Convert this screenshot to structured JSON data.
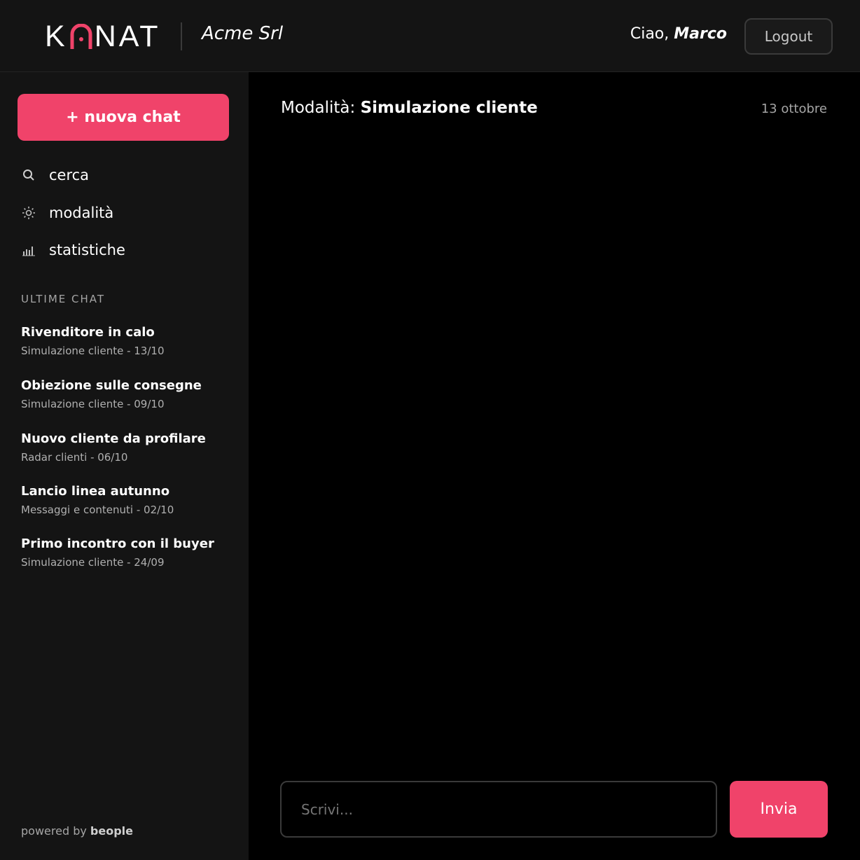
{
  "header": {
    "logo_left": "K",
    "logo_right": "NAT",
    "company": "Acme Srl",
    "greeting_prefix": "Ciao, ",
    "user_name": "Marco",
    "logout_label": "Logout"
  },
  "sidebar": {
    "new_chat_label": "+ nuova chat",
    "nav": [
      {
        "label": "cerca",
        "icon": "search-icon"
      },
      {
        "label": "modalità",
        "icon": "sun-icon"
      },
      {
        "label": "statistiche",
        "icon": "bar-chart-icon"
      }
    ],
    "section_label": "ULTIME CHAT",
    "chats": [
      {
        "title": "Rivenditore in calo",
        "subtitle": "Simulazione cliente - 13/10"
      },
      {
        "title": "Obiezione sulle consegne",
        "subtitle": "Simulazione cliente - 09/10"
      },
      {
        "title": "Nuovo cliente da profilare",
        "subtitle": "Radar clienti - 06/10"
      },
      {
        "title": "Lancio linea autunno",
        "subtitle": "Messaggi e contenuti - 02/10"
      },
      {
        "title": "Primo incontro con il buyer",
        "subtitle": "Simulazione cliente - 24/09"
      }
    ],
    "powered_prefix": "powered by ",
    "powered_brand": "beople"
  },
  "main": {
    "title_prefix": "Modalità: ",
    "mode": "Simulazione cliente",
    "date": "13 ottobre"
  },
  "composer": {
    "placeholder": "Scrivi...",
    "send_label": "Invia"
  },
  "colors": {
    "accent": "#f0436a",
    "background": "#000000",
    "panel": "#141414"
  }
}
